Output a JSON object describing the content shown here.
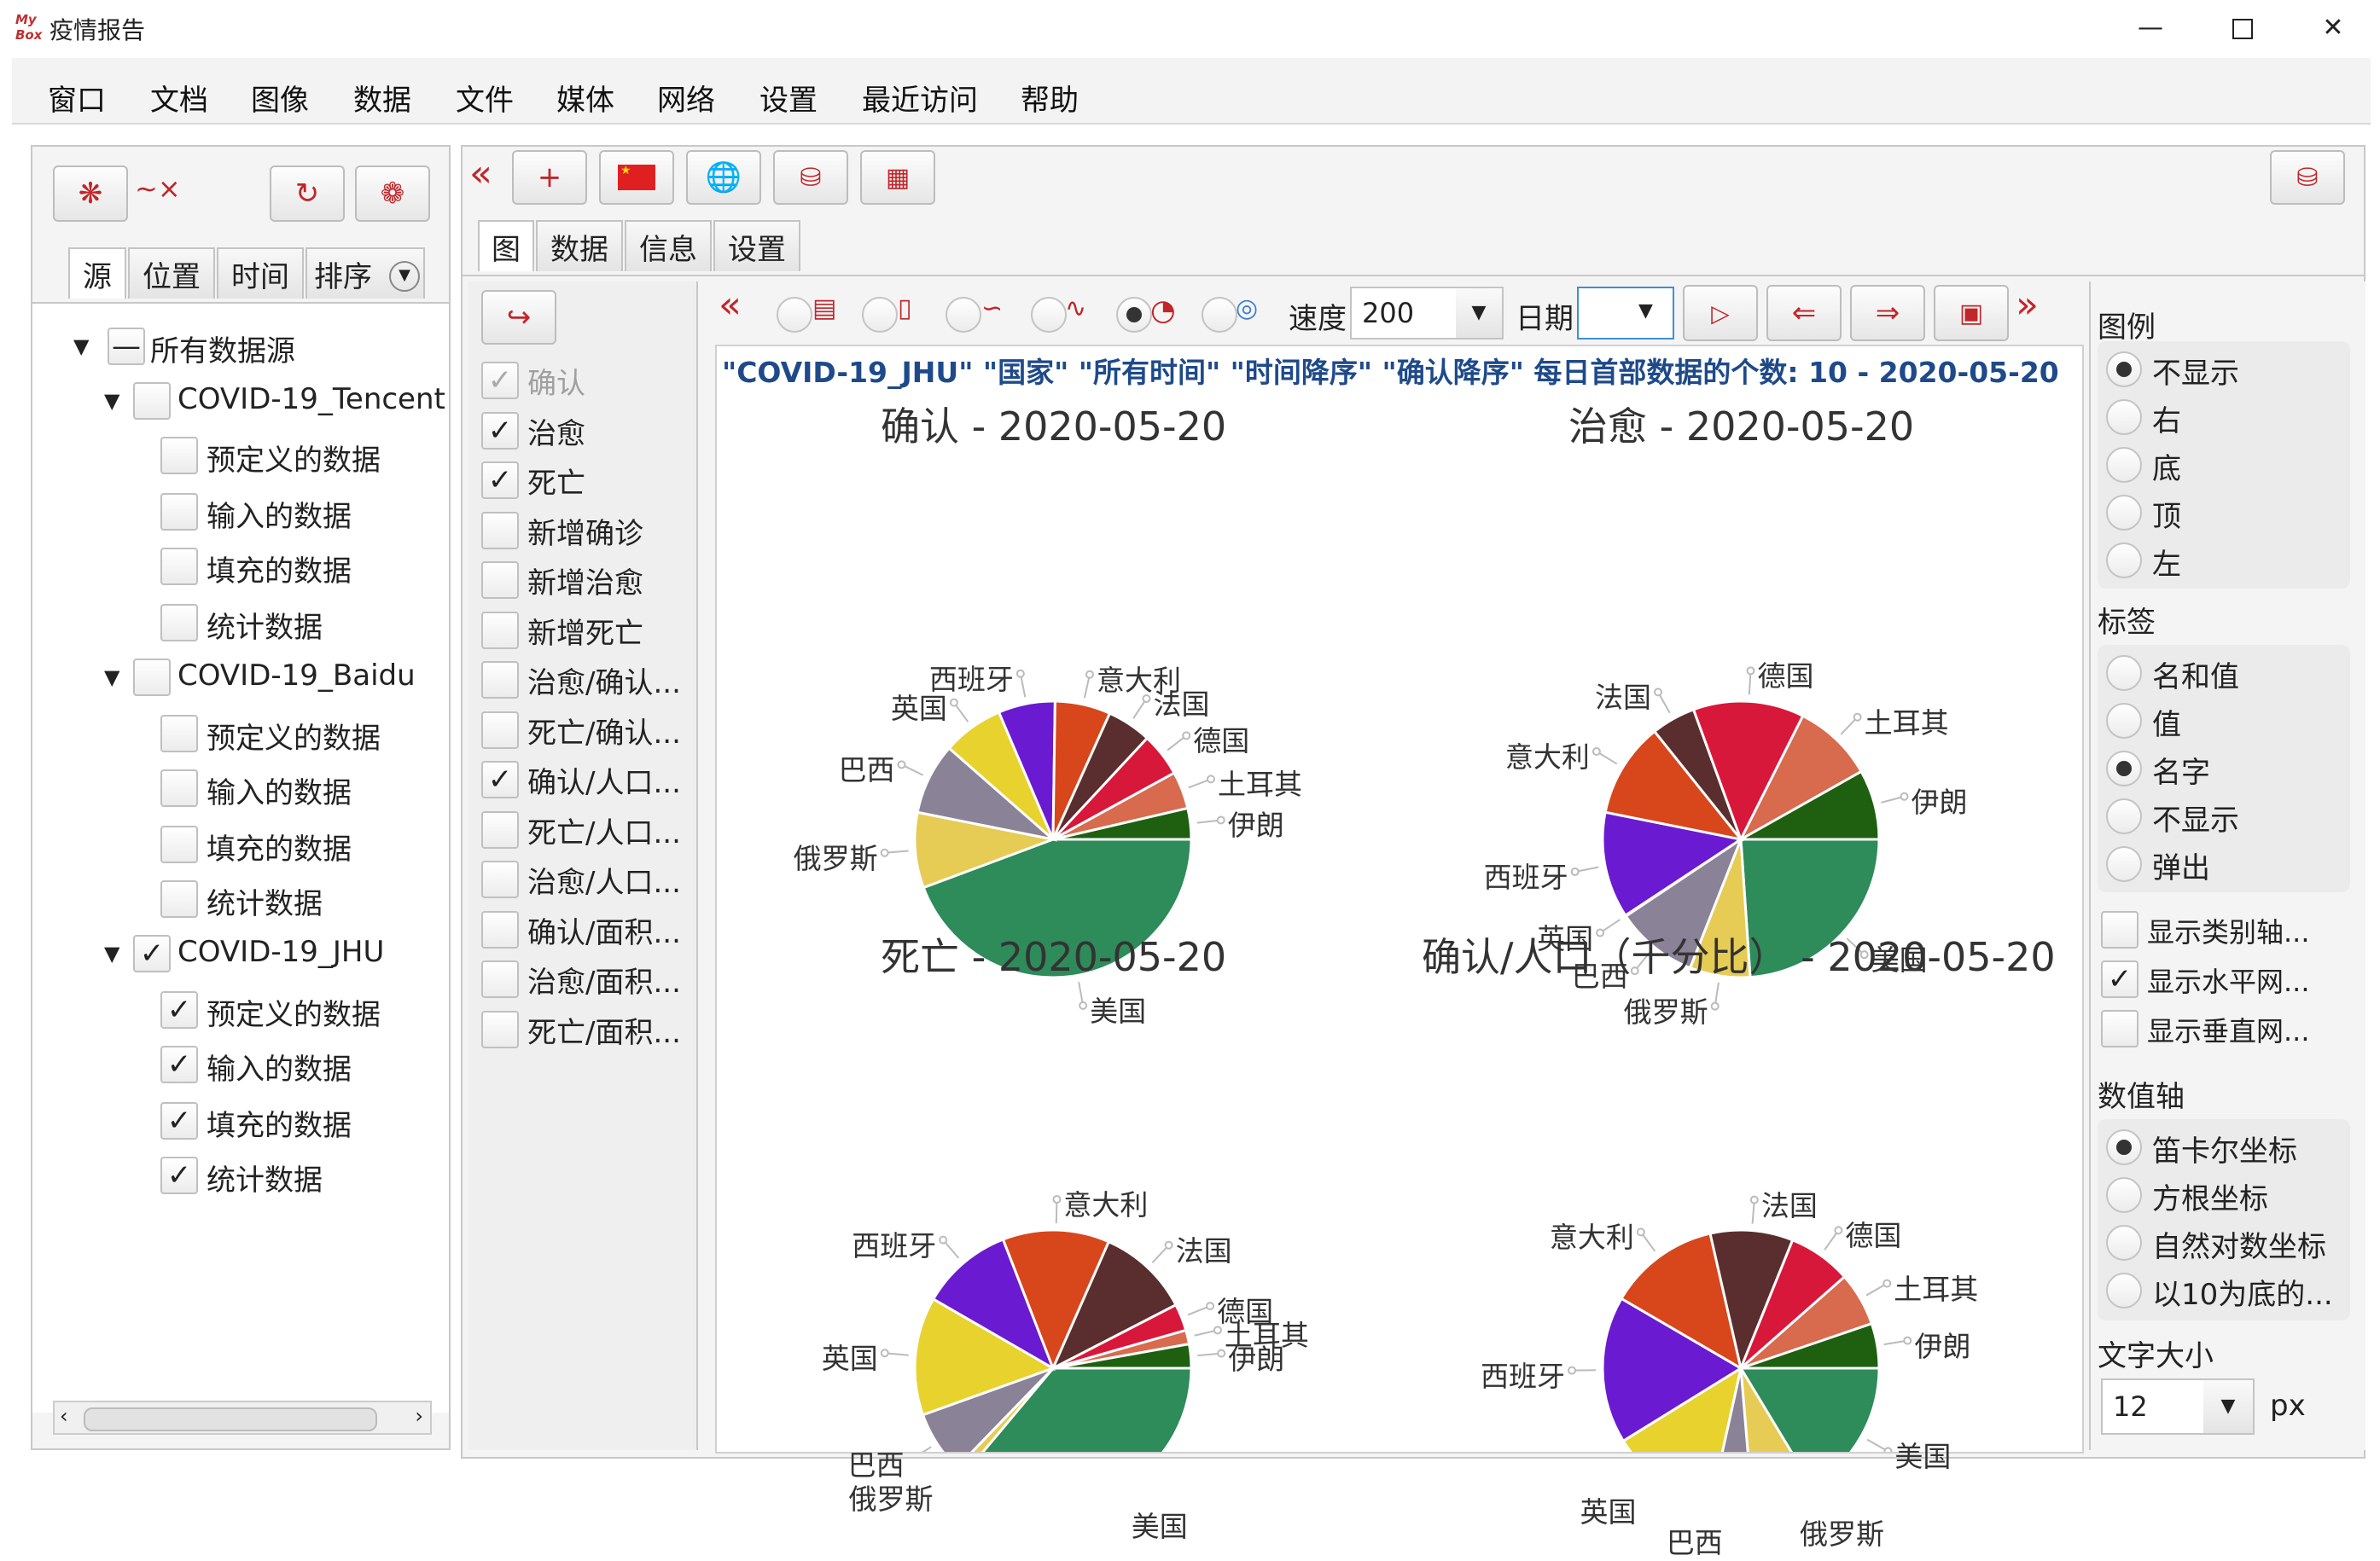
{
  "app": {
    "title": "疫情报告",
    "logo": "My Box"
  },
  "menu": [
    "窗口",
    "文档",
    "图像",
    "数据",
    "文件",
    "媒体",
    "网络",
    "设置",
    "最近访问",
    "帮助"
  ],
  "left_panel": {
    "tabs": [
      "源",
      "位置",
      "时间",
      "排序"
    ],
    "tree": {
      "root": "所有数据源",
      "sources": [
        {
          "name": "COVID-19_Tencent",
          "checked": false,
          "children": [
            "预定义的数据",
            "输入的数据",
            "填充的数据",
            "统计数据"
          ]
        },
        {
          "name": "COVID-19_Baidu",
          "checked": false,
          "children": [
            "预定义的数据",
            "输入的数据",
            "填充的数据",
            "统计数据"
          ]
        },
        {
          "name": "COVID-19_JHU",
          "checked": true,
          "children": [
            "预定义的数据",
            "输入的数据",
            "填充的数据",
            "统计数据"
          ]
        }
      ]
    }
  },
  "main_tabs": [
    "图",
    "数据",
    "信息",
    "设置"
  ],
  "measures": [
    {
      "label": "确认",
      "checked": true,
      "disabled": true
    },
    {
      "label": "治愈",
      "checked": true
    },
    {
      "label": "死亡",
      "checked": true
    },
    {
      "label": "新增确诊",
      "checked": false
    },
    {
      "label": "新增治愈",
      "checked": false
    },
    {
      "label": "新增死亡",
      "checked": false
    },
    {
      "label": "治愈/确认...",
      "checked": false
    },
    {
      "label": "死亡/确认...",
      "checked": false
    },
    {
      "label": "确认/人口...",
      "checked": true
    },
    {
      "label": "死亡/人口...",
      "checked": false
    },
    {
      "label": "治愈/人口...",
      "checked": false
    },
    {
      "label": "确认/面积...",
      "checked": false
    },
    {
      "label": "治愈/面积...",
      "checked": false
    },
    {
      "label": "死亡/面积...",
      "checked": false
    }
  ],
  "chart_toolbar": {
    "speed_label": "速度",
    "speed_value": "200",
    "date_label": "日期",
    "date_value": ""
  },
  "summary": "\"COVID-19_JHU\" \"国家\" \"所有时间\" \"时间降序\" \"确认降序\" 每日首部数据的个数: 10 - 2020-05-20",
  "right_panel": {
    "legend_title": "图例",
    "legend_options": [
      "不显示",
      "右",
      "底",
      "顶",
      "左"
    ],
    "legend_selected": 0,
    "label_title": "标签",
    "label_options": [
      "名和值",
      "值",
      "名字",
      "不显示",
      "弹出"
    ],
    "label_selected": 2,
    "checks": [
      {
        "label": "显示类别轴...",
        "checked": false
      },
      {
        "label": "显示水平网...",
        "checked": true
      },
      {
        "label": "显示垂直网...",
        "checked": false
      }
    ],
    "axis_title": "数值轴",
    "axis_options": [
      "笛卡尔坐标",
      "方根坐标",
      "自然对数坐标",
      "以10为底的..."
    ],
    "axis_selected": 0,
    "font_title": "文字大小",
    "font_value": "12",
    "font_unit": "px"
  },
  "colors": {
    "美国": "#2e8b5a",
    "俄罗斯": "#e6cc55",
    "巴西": "#8a8296",
    "英国": "#e8d22e",
    "西班牙": "#6a1ad0",
    "意大利": "#d8461c",
    "法国": "#5a2e2e",
    "德国": "#d8183a",
    "土耳其": "#d86a4e",
    "伊朗": "#1e6010"
  },
  "chart_data": [
    {
      "type": "pie",
      "title": "确认 - 2020-05-20",
      "slices": [
        {
          "label": "美国",
          "value": 1551853
        },
        {
          "label": "俄罗斯",
          "value": 308705
        },
        {
          "label": "巴西",
          "value": 291579
        },
        {
          "label": "英国",
          "value": 249619
        },
        {
          "label": "西班牙",
          "value": 232555
        },
        {
          "label": "意大利",
          "value": 227364
        },
        {
          "label": "法国",
          "value": 181700
        },
        {
          "label": "德国",
          "value": 178473
        },
        {
          "label": "土耳其",
          "value": 152587
        },
        {
          "label": "伊朗",
          "value": 126949
        }
      ]
    },
    {
      "type": "pie",
      "title": "治愈 - 2020-05-20",
      "slices": [
        {
          "label": "美国",
          "value": 289392
        },
        {
          "label": "俄罗斯",
          "value": 85392
        },
        {
          "label": "巴西",
          "value": 116683
        },
        {
          "label": "英国",
          "value": 1130
        },
        {
          "label": "西班牙",
          "value": 150376
        },
        {
          "label": "意大利",
          "value": 134560
        },
        {
          "label": "法国",
          "value": 62563
        },
        {
          "label": "德国",
          "value": 156966
        },
        {
          "label": "土耳其",
          "value": 113987
        },
        {
          "label": "伊朗",
          "value": 98808
        }
      ]
    },
    {
      "type": "pie",
      "title": "死亡 - 2020-05-20",
      "slices": [
        {
          "label": "美国",
          "value": 93439
        },
        {
          "label": "俄罗斯",
          "value": 2972
        },
        {
          "label": "巴西",
          "value": 18859
        },
        {
          "label": "英国",
          "value": 35786
        },
        {
          "label": "西班牙",
          "value": 27888
        },
        {
          "label": "意大利",
          "value": 32330
        },
        {
          "label": "法国",
          "value": 28025
        },
        {
          "label": "德国",
          "value": 8144
        },
        {
          "label": "土耳其",
          "value": 4222
        },
        {
          "label": "伊朗",
          "value": 7249
        }
      ]
    },
    {
      "type": "pie",
      "title": "确认/人口（千分比） - 2020-05-20",
      "slices": [
        {
          "label": "美国",
          "value": 4.72
        },
        {
          "label": "俄罗斯",
          "value": 2.11
        },
        {
          "label": "巴西",
          "value": 1.38
        },
        {
          "label": "英国",
          "value": 3.67
        },
        {
          "label": "西班牙",
          "value": 4.97
        },
        {
          "label": "意大利",
          "value": 3.76
        },
        {
          "label": "法国",
          "value": 2.79
        },
        {
          "label": "德国",
          "value": 2.13
        },
        {
          "label": "土耳其",
          "value": 1.81
        },
        {
          "label": "伊朗",
          "value": 1.51
        }
      ]
    }
  ]
}
